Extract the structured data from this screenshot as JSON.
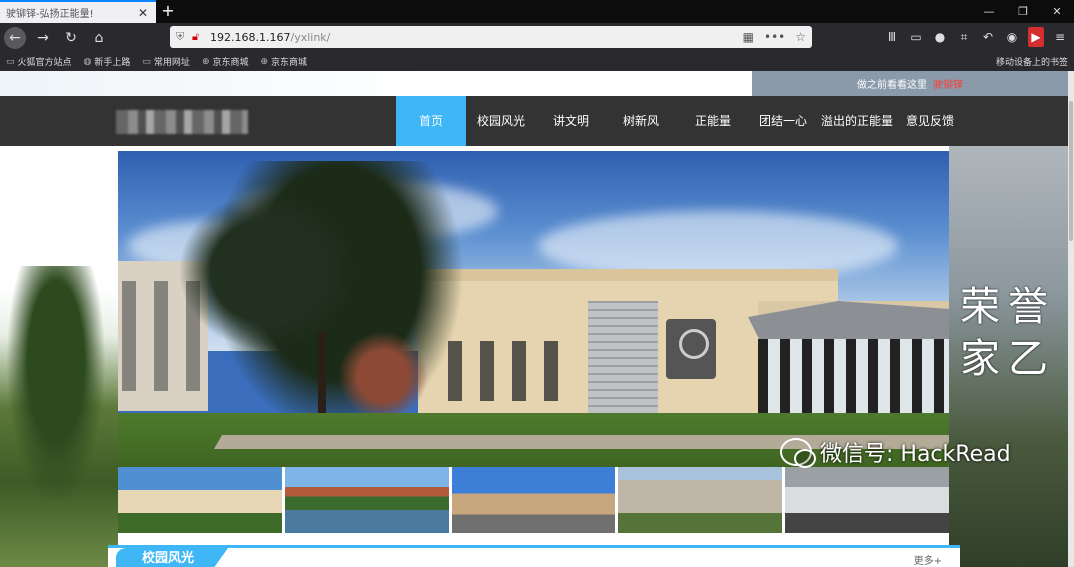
{
  "browser": {
    "tab_title": "驶铆铎-弘扬正能量!",
    "tab_close": "✕",
    "new_tab": "+",
    "window_controls": [
      "—",
      "❐",
      "✕"
    ],
    "url_host": "192.168.1.167",
    "url_path": "/yxlink/",
    "bookmarks": [
      "火狐官方站点",
      "新手上路",
      "常用网址",
      "京东商城",
      "京东商城"
    ],
    "mobile_bookmarks": "移动设备上的书签"
  },
  "site": {
    "topbar_text": "做之前看看这里",
    "topbar_link": "驶铆铎",
    "menu": [
      {
        "label": "首页",
        "active": true
      },
      {
        "label": "校园风光",
        "active": false
      },
      {
        "label": "讲文明",
        "active": false
      },
      {
        "label": "树新风",
        "active": false
      },
      {
        "label": "正能量",
        "active": false
      },
      {
        "label": "团结一心",
        "active": false
      },
      {
        "label": "溢出的正能量",
        "active": false
      },
      {
        "label": "意见反馈",
        "active": false
      }
    ],
    "calligraphy": "荣誉 家乙",
    "section_title": "校园风光",
    "section_more": "更多+"
  },
  "watermark": "微信号: HackRead",
  "colors": {
    "accent": "#3fb6f5",
    "nav_bg": "#333333"
  }
}
